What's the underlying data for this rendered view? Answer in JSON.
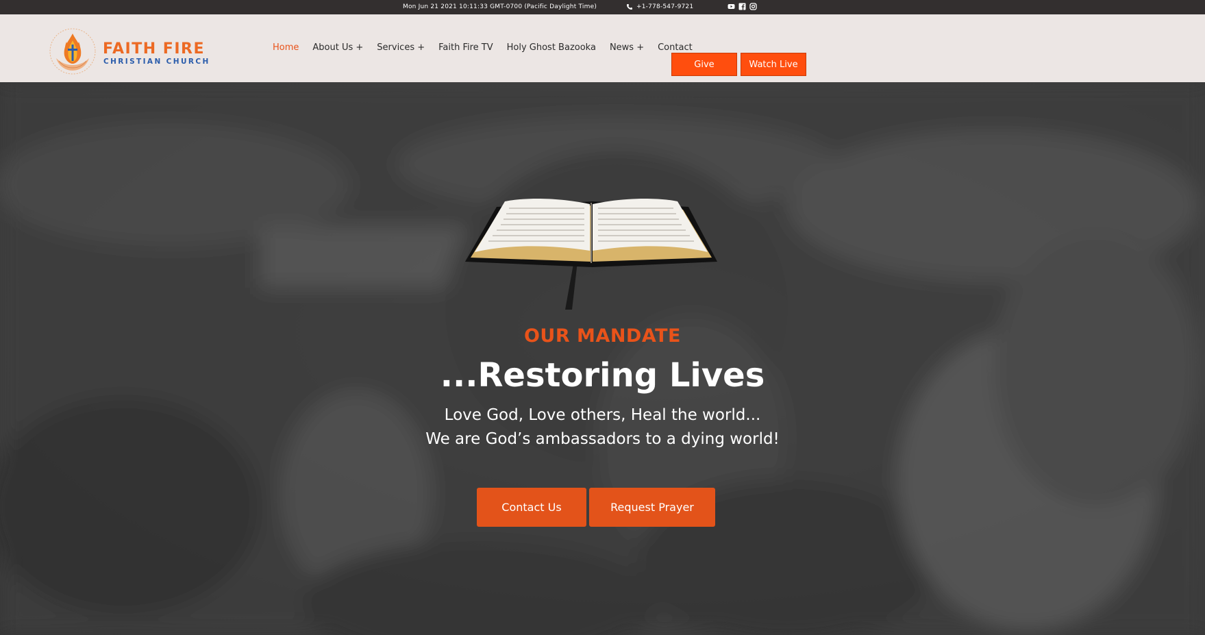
{
  "topbar": {
    "datetime": "Mon Jun 21 2021 10:11:33 GMT-0700 (Pacific Daylight Time)",
    "phone": "+1-778-547-9721",
    "social_icons": [
      "youtube-icon",
      "facebook-icon",
      "instagram-icon"
    ]
  },
  "logo": {
    "title": "FAITH FIRE",
    "subtitle": "CHRISTIAN CHURCH",
    "ring_text": "LOVE GOD, LOVE OTHERS, HEAL THE WORLD"
  },
  "nav": {
    "items": [
      {
        "label": "Home",
        "active": true
      },
      {
        "label": "About Us +"
      },
      {
        "label": "Services +"
      },
      {
        "label": "Faith Fire TV"
      },
      {
        "label": "Holy Ghost Bazooka"
      },
      {
        "label": "News +"
      },
      {
        "label": "Contact"
      }
    ],
    "give_label": "Give",
    "watch_label": "Watch Live"
  },
  "hero": {
    "eyebrow": "OUR MANDATE",
    "title": "...Restoring Lives",
    "line1": "Love God, Love others, Heal the world...",
    "line2": "We are God’s ambassadors to a dying world!",
    "contact_label": "Contact Us",
    "prayer_label": "Request Prayer"
  },
  "colors": {
    "accent": "#e9531a",
    "button": "#ff4e0e",
    "topbar_bg": "#332f2f",
    "header_bg": "#ece6e4",
    "logo_blue": "#2a5cab"
  }
}
